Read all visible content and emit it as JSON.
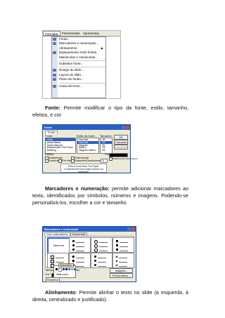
{
  "screenshot1": {
    "menubar": [
      "Formatar",
      "Ferramentas",
      "Apresentaç"
    ],
    "menu_items": [
      {
        "label": "Fonte...",
        "icon": "font-icon"
      },
      {
        "label": "Marcadores e numeração...",
        "icon": "bullets-icon"
      },
      {
        "label": "Alinhamento",
        "icon": "",
        "submenu": true
      },
      {
        "label": "Espaçamento entre linhas...",
        "icon": "line-spacing-icon"
      },
      {
        "label": "Maiúsculas e minúsculas...",
        "icon": ""
      },
      {
        "label": "Substituir fonte...",
        "icon": ""
      },
      {
        "label": "Design do slide...",
        "icon": "slide-design-icon"
      },
      {
        "label": "Layout do slide...",
        "icon": "slide-layout-icon"
      },
      {
        "label": "Plano de fundo...",
        "icon": "background-icon"
      },
      {
        "label": "Caixa de texto...",
        "icon": "textbox-icon"
      }
    ]
  },
  "para1": {
    "term": "Fonte:",
    "text": " Permite modificar o tipo da fonte, estilo, tamanho, efeitos, e cor"
  },
  "screenshot2": {
    "title": "Fonte",
    "tab": "Fonte",
    "font_label": "Fonte:",
    "style_label": "Estilo da fonte:",
    "size_label": "Tamanho:",
    "fonts": [
      "Arial",
      "Arial Black",
      "Arial Narrow",
      "Baskerville Old Face",
      "Batang"
    ],
    "styles": [
      "Normal",
      "Normal",
      "Negrito",
      "Itálico",
      "Negrito Itálico"
    ],
    "sizes": [
      "18",
      "18",
      "20",
      "24",
      "28"
    ],
    "buttons": {
      "ok": "OK",
      "cancel": "Cancelar",
      "preview": "Visualizar"
    },
    "effects_label": "Efeitos",
    "effects": [
      "Sublinhado",
      "Sombra",
      "Em relevo",
      "Sobrescrito",
      "Subscrito"
    ],
    "offset_label": "Deslocamento:",
    "offset_value": "0",
    "color_label": "Cor:",
    "default_label": "Padrão para novos objetos",
    "preview_line1": "Esta é uma fonte TrueType.",
    "preview_line2": "A mesma fonte será usada na tela e na impressão."
  },
  "para2": {
    "term": "Marcadores e numeração:",
    "text": " permite adicionar marcadores ao texto, identificados por símbolos, números e imagens. Podendo-se personalizá-los, escolher a cor e tamanho."
  },
  "screenshot3": {
    "title": "Marcadores e numeração",
    "tabs": [
      "Com marcadores",
      "Numerada"
    ],
    "none_label": "Nenhum",
    "size_label": "Tamanho:",
    "size_value": "100",
    "size_unit": "% do texto",
    "color_label": "Cor:",
    "popup_label": "Automático",
    "more_colors": "Mais cores...",
    "buttons": {
      "image": "Imagem...",
      "custom": "Personalizar...",
      "reset": "Redefinir"
    }
  },
  "para3": {
    "term": "Alinhamento",
    "text": ": Permite alinhar o texto no slide (à esquerda, à direita, centralizado e justificado)."
  }
}
